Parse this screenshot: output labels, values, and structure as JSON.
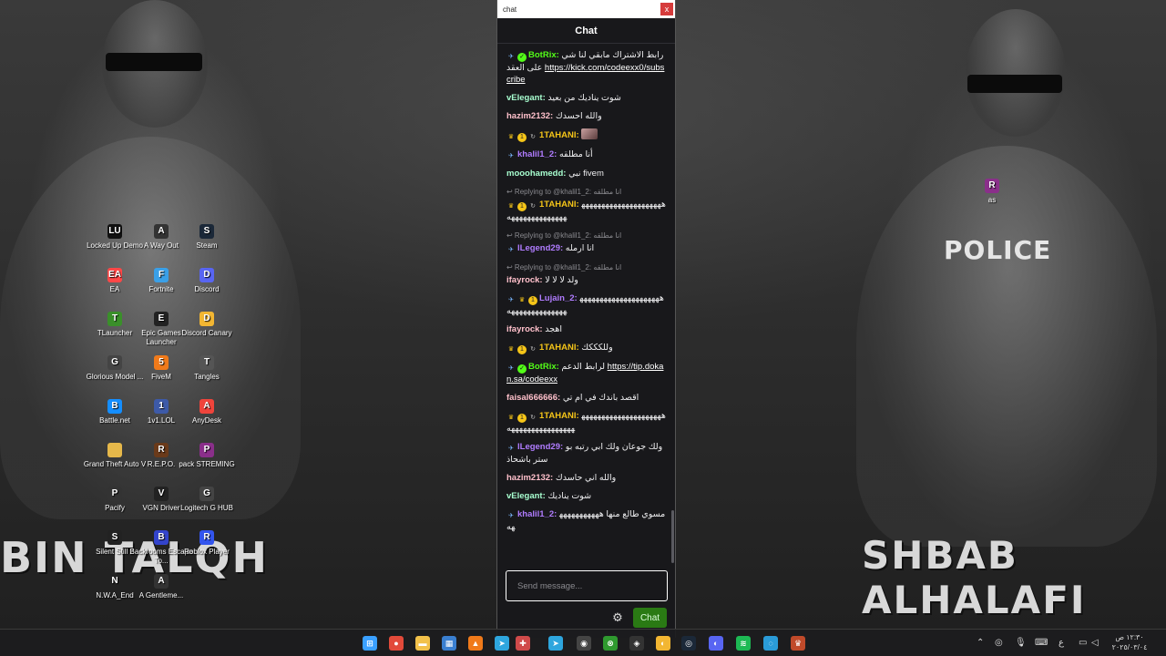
{
  "wallpaper": {
    "left_caption": "BIN TALQH",
    "right_caption": "SHBAB ALHALAFI",
    "patch_text": "POLICE"
  },
  "desktop_icons": [
    {
      "label": "Locked Up Demo",
      "icon": "lu-icon",
      "color": "#111111",
      "glyph": "LU"
    },
    {
      "label": "A Way Out",
      "icon": "awo-icon",
      "color": "#333333",
      "glyph": "A"
    },
    {
      "label": "Steam",
      "icon": "steam-icon",
      "color": "#1b2838",
      "glyph": "S"
    },
    {
      "label": "EA",
      "icon": "ea-icon",
      "color": "#ff4747",
      "glyph": "EA"
    },
    {
      "label": "Fortnite",
      "icon": "fortnite-icon",
      "color": "#3aa0e8",
      "glyph": "F"
    },
    {
      "label": "Discord",
      "icon": "discord-icon",
      "color": "#5865f2",
      "glyph": "D"
    },
    {
      "label": "TLauncher",
      "icon": "tlauncher-icon",
      "color": "#3a8f2a",
      "glyph": "T"
    },
    {
      "label": "Epic Games Launcher",
      "icon": "epic-icon",
      "color": "#222222",
      "glyph": "E"
    },
    {
      "label": "Discord Canary",
      "icon": "discord-canary-icon",
      "color": "#f2b632",
      "glyph": "D"
    },
    {
      "label": "Glorious Model ...",
      "icon": "glorious-icon",
      "color": "#444444",
      "glyph": "G"
    },
    {
      "label": "FiveM",
      "icon": "fivem-icon",
      "color": "#f07a1a",
      "glyph": "5"
    },
    {
      "label": "Tangles",
      "icon": "tangles-icon",
      "color": "#555555",
      "glyph": "T"
    },
    {
      "label": "Battle.net",
      "icon": "battlenet-icon",
      "color": "#148eff",
      "glyph": "B"
    },
    {
      "label": "1v1.LOL",
      "icon": "onevone-icon",
      "color": "#3d5aa8",
      "glyph": "1"
    },
    {
      "label": "AnyDesk",
      "icon": "anydesk-icon",
      "color": "#ef443b",
      "glyph": "A"
    },
    {
      "label": "Grand Theft Auto V",
      "icon": "folder-icon",
      "color": "#e6b84a",
      "glyph": ""
    },
    {
      "label": "R.E.P.O.",
      "icon": "repo-icon",
      "color": "#6a3a1a",
      "glyph": "R"
    },
    {
      "label": "pack STREMING",
      "icon": "winrar-icon",
      "color": "#8a2f8a",
      "glyph": "P"
    },
    {
      "label": "Pacify",
      "icon": "pacify-icon",
      "color": "#333333",
      "glyph": "P"
    },
    {
      "label": "VGN Driver",
      "icon": "vgn-icon",
      "color": "#222222",
      "glyph": "V"
    },
    {
      "label": "Logitech G HUB",
      "icon": "logitech-icon",
      "color": "#444444",
      "glyph": "G"
    },
    {
      "label": "Silent Still 2",
      "icon": "silentstill-icon",
      "color": "#222222",
      "glyph": "S"
    },
    {
      "label": "Backrooms Escape To...",
      "icon": "backrooms-icon",
      "color": "#3344cc",
      "glyph": "B"
    },
    {
      "label": "Roblox Player",
      "icon": "roblox-icon",
      "color": "#3355ee",
      "glyph": "R"
    },
    {
      "label": "N.W.A_End",
      "icon": "nwa-icon",
      "color": "#222222",
      "glyph": "N"
    },
    {
      "label": "A Gentleme...",
      "icon": "gentleman-icon",
      "color": "#333333",
      "glyph": "A"
    }
  ],
  "right_desktop_icon": {
    "label": "as",
    "icon": "winrar-icon",
    "color": "#8a2f8a",
    "glyph": "R"
  },
  "chat": {
    "window_title": "chat",
    "close_glyph": "x",
    "header": "Chat",
    "messages": [
      {
        "badges": [
          "bot",
          "check"
        ],
        "user": "BotRix",
        "user_color": "#53fc18",
        "text": "رابط الاشتراك مابقي لنا شي على العقد ",
        "link": "https://kick.com/codeexx0/subscribe"
      },
      {
        "badges": [],
        "user": "vElegant",
        "user_color": "#a8ffd0",
        "text": "شوت يناديك من بعيد"
      },
      {
        "badges": [],
        "user": "hazim2132",
        "user_color": "#ffc0cb",
        "text": "والله احسدك"
      },
      {
        "badges": [
          "crown",
          "coin",
          "refresh"
        ],
        "user": "1TAHANI",
        "user_color": "#f5c518",
        "text": "",
        "emote": true
      },
      {
        "badges": [
          "bot"
        ],
        "user": "khalil1_2",
        "user_color": "#b07cff",
        "text": "أنا مطلقه"
      },
      {
        "badges": [],
        "user": "mooohamedd",
        "user_color": "#a8ffd0",
        "text": "نبي fivem"
      },
      {
        "reply": "Replying to @khalil1_2: انا مطلقه",
        "badges": [
          "crown",
          "coin",
          "refresh"
        ],
        "user": "1TAHANI",
        "user_color": "#f5c518",
        "text": "هههههههههههههههههههههههههههههههههههه"
      },
      {
        "reply": "Replying to @khalil1_2: انا مطلقه",
        "badges": [
          "bot"
        ],
        "user": "lLegend29",
        "user_color": "#b07cff",
        "text": "انا ارمله"
      },
      {
        "reply": "Replying to @khalil1_2: انا مطلقه",
        "badges": [],
        "user": "ifayrock",
        "user_color": "#ffc0cb",
        "text": "ولد لا لا لا"
      },
      {
        "badges": [
          "bot",
          "crown",
          "coin"
        ],
        "user": "Lujain_2",
        "user_color": "#b07cff",
        "text": "هههههههههههههههههههههههههههههههههههه"
      },
      {
        "badges": [],
        "user": "ifayrock",
        "user_color": "#ffc0cb",
        "text": "اهجد"
      },
      {
        "badges": [
          "crown",
          "coin",
          "refresh"
        ],
        "user": "1TAHANI",
        "user_color": "#f5c518",
        "text": "وللكككك"
      },
      {
        "badges": [
          "bot",
          "check"
        ],
        "user": "BotRix",
        "user_color": "#53fc18",
        "text": "لرابط الدعم ",
        "link": "https://tip.dokan.sa/codeexx"
      },
      {
        "badges": [],
        "user": "faisal666666",
        "user_color": "#ffc0cb",
        "text": "اقصد باندك في ام تي"
      },
      {
        "badges": [
          "crown",
          "coin",
          "refresh"
        ],
        "user": "1TAHANI",
        "user_color": "#f5c518",
        "text": "هههههههههههههههههههههههههههههههههههههه"
      },
      {
        "badges": [
          "bot"
        ],
        "user": "lLegend29",
        "user_color": "#b07cff",
        "text": "ولك جوعان ولك ابي رتبه بوستر باشحاذ"
      },
      {
        "badges": [],
        "user": "hazim2132",
        "user_color": "#ffc0cb",
        "text": "والله اني حاسدك"
      },
      {
        "badges": [],
        "user": "vElegant",
        "user_color": "#a8ffd0",
        "text": "شوت يناديك"
      },
      {
        "badges": [
          "bot"
        ],
        "user": "khalil1_2",
        "user_color": "#b07cff",
        "text": "مسوي طالع منها ههههههههههههه"
      }
    ],
    "input_placeholder": "Send message...",
    "settings_icon": "gear-icon",
    "send_label": "Chat"
  },
  "taskbar": {
    "icons": [
      {
        "name": "start-icon",
        "color": "#3aa0ff",
        "glyph": "⊞"
      },
      {
        "name": "chrome-icon",
        "color": "#e24a3a",
        "glyph": "●"
      },
      {
        "name": "file-explorer-icon",
        "color": "#f2c14a",
        "glyph": "▬"
      },
      {
        "name": "store-icon",
        "color": "#3a7fd0",
        "glyph": "▦"
      },
      {
        "name": "fivem-icon",
        "color": "#f07a1a",
        "glyph": "▲"
      },
      {
        "name": "telegram-icon",
        "color": "#2ea6de",
        "glyph": "➤"
      },
      {
        "name": "snipping-tool-icon",
        "color": "#d04a4a",
        "glyph": "✚"
      },
      {
        "name": "telegram-icon-2",
        "color": "#2ea6de",
        "glyph": "➤"
      },
      {
        "name": "obs-icon",
        "color": "#444444",
        "glyph": "◉"
      },
      {
        "name": "xbox-icon",
        "color": "#2f9a2f",
        "glyph": "⊗"
      },
      {
        "name": "capcut-icon",
        "color": "#333333",
        "glyph": "◈"
      },
      {
        "name": "discord-canary-icon",
        "color": "#f2b632",
        "glyph": "◐"
      },
      {
        "name": "steam-icon",
        "color": "#1b2838",
        "glyph": "◎"
      },
      {
        "name": "discord-icon",
        "color": "#5865f2",
        "glyph": "◐"
      },
      {
        "name": "spotify-icon",
        "color": "#1db954",
        "glyph": "≋"
      },
      {
        "name": "edge-icon",
        "color": "#2a9bd8",
        "glyph": "◌"
      },
      {
        "name": "kick-app-icon",
        "color": "#c04a2a",
        "glyph": "♛"
      }
    ],
    "tray": {
      "chevron": "⌃",
      "lang": "ع",
      "time": "١٢:٣٠ ص",
      "date": "٢٠٢٥/٠٣/٠٤"
    }
  }
}
